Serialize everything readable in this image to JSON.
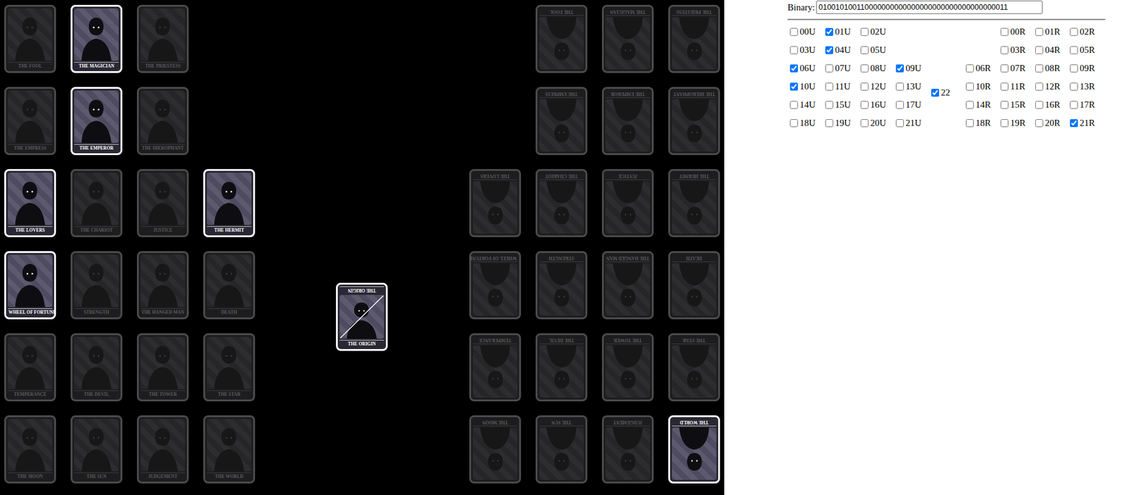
{
  "cards": {
    "upright": [
      {
        "name": "THE FOOL",
        "selected": false
      },
      {
        "name": "THE MAGICIAN",
        "selected": true
      },
      {
        "name": "THE PRIESTESS",
        "selected": false
      },
      {
        "name": "THE EMPRESS",
        "selected": false
      },
      {
        "name": "THE EMPEROR",
        "selected": true
      },
      {
        "name": "THE HIEROPHANT",
        "selected": false
      },
      {
        "name": "THE LOVERS",
        "selected": true
      },
      {
        "name": "THE CHARIOT",
        "selected": false
      },
      {
        "name": "JUSTICE",
        "selected": false
      },
      {
        "name": "THE HERMIT",
        "selected": true
      },
      {
        "name": "WHEEL OF FORTUNE",
        "selected": true
      },
      {
        "name": "STRENGTH",
        "selected": false
      },
      {
        "name": "THE HANGED MAN",
        "selected": false
      },
      {
        "name": "DEATH",
        "selected": false
      },
      {
        "name": "TEMPERANCE",
        "selected": false
      },
      {
        "name": "THE DEVIL",
        "selected": false
      },
      {
        "name": "THE TOWER",
        "selected": false
      },
      {
        "name": "THE STAR",
        "selected": false
      },
      {
        "name": "THE MOON",
        "selected": false
      },
      {
        "name": "THE SUN",
        "selected": false
      },
      {
        "name": "JUDGEMENT",
        "selected": false
      },
      {
        "name": "THE WORLD",
        "selected": false
      }
    ],
    "reversed": [
      {
        "name": "THE FOOL",
        "selected": false
      },
      {
        "name": "THE MAGICIAN",
        "selected": false
      },
      {
        "name": "THE PRIESTESS",
        "selected": false
      },
      {
        "name": "THE EMPRESS",
        "selected": false
      },
      {
        "name": "THE EMPEROR",
        "selected": false
      },
      {
        "name": "THE HIEROPHANT",
        "selected": false
      },
      {
        "name": "THE LOVERS",
        "selected": false
      },
      {
        "name": "THE CHARIOT",
        "selected": false
      },
      {
        "name": "JUSTICE",
        "selected": false
      },
      {
        "name": "THE HERMIT",
        "selected": false
      },
      {
        "name": "WHEEL OF FORTUNE",
        "selected": false
      },
      {
        "name": "STRENGTH",
        "selected": false
      },
      {
        "name": "THE HANGED MAN",
        "selected": false
      },
      {
        "name": "DEATH",
        "selected": false
      },
      {
        "name": "TEMPERANCE",
        "selected": false
      },
      {
        "name": "THE DEVIL",
        "selected": false
      },
      {
        "name": "THE TOWER",
        "selected": false
      },
      {
        "name": "THE STAR",
        "selected": false
      },
      {
        "name": "THE MOON",
        "selected": false
      },
      {
        "name": "THE SUN",
        "selected": false
      },
      {
        "name": "JUDGEMENT",
        "selected": false
      },
      {
        "name": "THE WORLD",
        "selected": true
      }
    ],
    "origin": {
      "top_label": "THE ORIGIN",
      "bottom_label": "THE ORIGIN",
      "selected": true
    }
  },
  "binary": {
    "label": "Binary:",
    "value": "010010100110000000000000000000000000000000011"
  },
  "checkboxes": {
    "upright": [
      {
        "label": "00U",
        "checked": false
      },
      {
        "label": "01U",
        "checked": true
      },
      {
        "label": "02U",
        "checked": false
      },
      {
        "label": "03U",
        "checked": false
      },
      {
        "label": "04U",
        "checked": true
      },
      {
        "label": "05U",
        "checked": false
      },
      {
        "label": "06U",
        "checked": true
      },
      {
        "label": "07U",
        "checked": false
      },
      {
        "label": "08U",
        "checked": false
      },
      {
        "label": "09U",
        "checked": true
      },
      {
        "label": "10U",
        "checked": true
      },
      {
        "label": "11U",
        "checked": false
      },
      {
        "label": "12U",
        "checked": false
      },
      {
        "label": "13U",
        "checked": false
      },
      {
        "label": "14U",
        "checked": false
      },
      {
        "label": "15U",
        "checked": false
      },
      {
        "label": "16U",
        "checked": false
      },
      {
        "label": "17U",
        "checked": false
      },
      {
        "label": "18U",
        "checked": false
      },
      {
        "label": "19U",
        "checked": false
      },
      {
        "label": "20U",
        "checked": false
      },
      {
        "label": "21U",
        "checked": false
      }
    ],
    "origin": {
      "label": "22",
      "checked": true
    },
    "reversed": [
      {
        "label": "00R",
        "checked": false
      },
      {
        "label": "01R",
        "checked": false
      },
      {
        "label": "02R",
        "checked": false
      },
      {
        "label": "03R",
        "checked": false
      },
      {
        "label": "04R",
        "checked": false
      },
      {
        "label": "05R",
        "checked": false
      },
      {
        "label": "06R",
        "checked": false
      },
      {
        "label": "07R",
        "checked": false
      },
      {
        "label": "08R",
        "checked": false
      },
      {
        "label": "09R",
        "checked": false
      },
      {
        "label": "10R",
        "checked": false
      },
      {
        "label": "11R",
        "checked": false
      },
      {
        "label": "12R",
        "checked": false
      },
      {
        "label": "13R",
        "checked": false
      },
      {
        "label": "14R",
        "checked": false
      },
      {
        "label": "15R",
        "checked": false
      },
      {
        "label": "16R",
        "checked": false
      },
      {
        "label": "17R",
        "checked": false
      },
      {
        "label": "18R",
        "checked": false
      },
      {
        "label": "19R",
        "checked": false
      },
      {
        "label": "20R",
        "checked": false
      },
      {
        "label": "21R",
        "checked": true
      }
    ]
  }
}
